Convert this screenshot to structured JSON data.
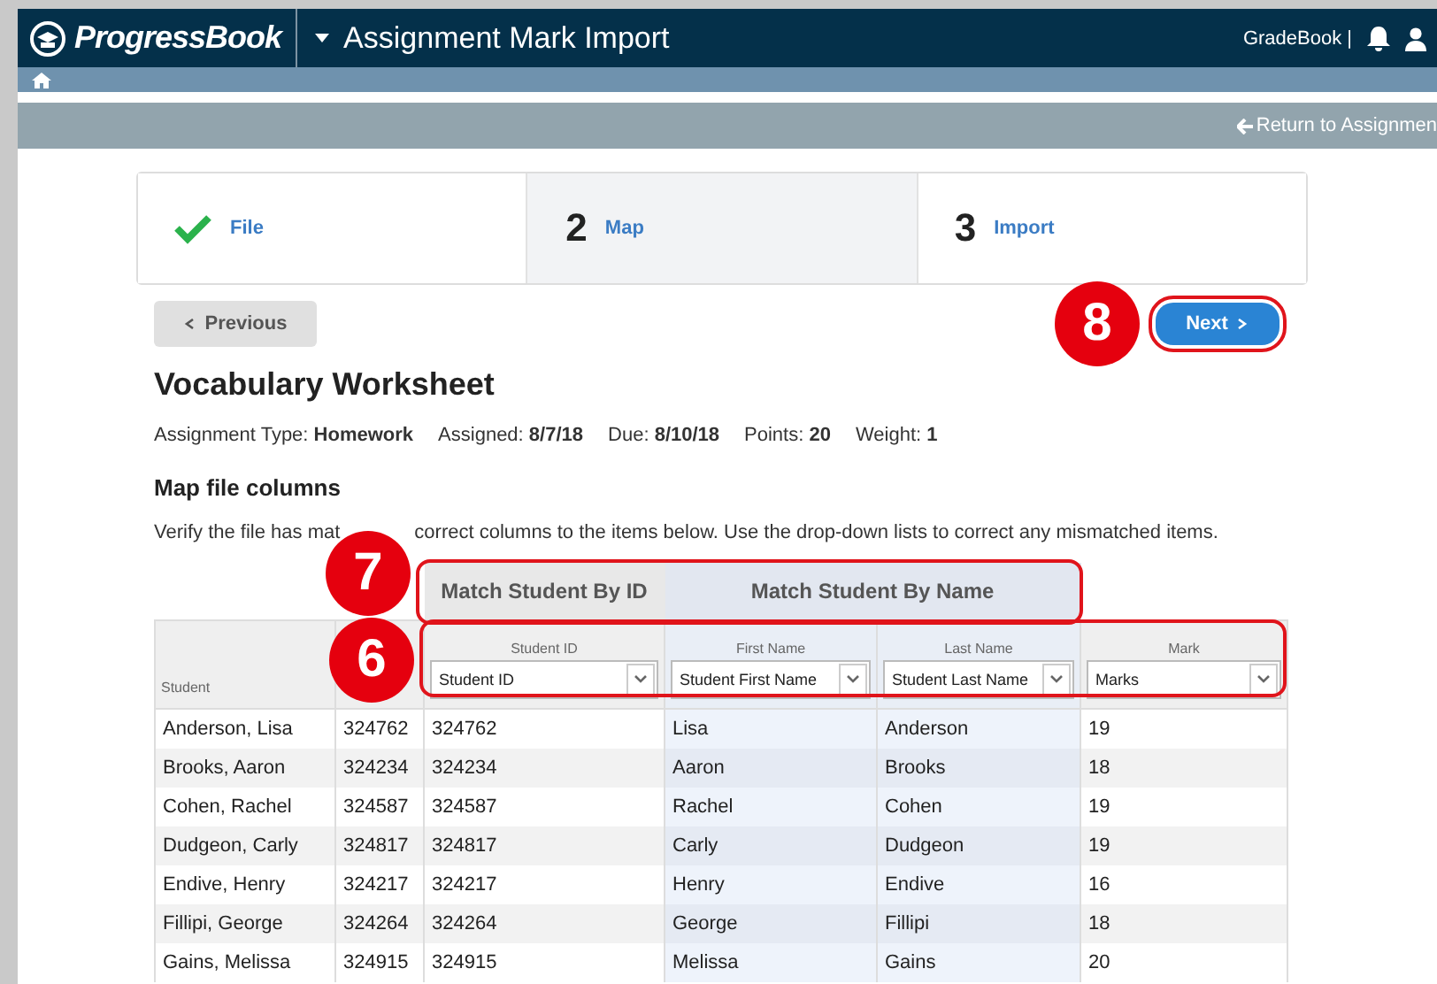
{
  "header": {
    "logo": "ProgressBook",
    "title": "Assignment Mark Import",
    "user_menu": "GradeBook |"
  },
  "return_link": "Return to Assignmen",
  "steps": [
    {
      "label": "File",
      "completed": true,
      "selected": false
    },
    {
      "number": "2",
      "label": "Map",
      "completed": false,
      "selected": true
    },
    {
      "number": "3",
      "label": "Import",
      "completed": false,
      "selected": false
    }
  ],
  "buttons": {
    "previous": "Previous",
    "next": "Next"
  },
  "assignment": {
    "title": "Vocabulary Worksheet",
    "details": [
      {
        "label": "Assignment Type:",
        "value": "Homework"
      },
      {
        "label": "Assigned:",
        "value": "8/7/18"
      },
      {
        "label": "Due:",
        "value": "8/10/18"
      },
      {
        "label": "Points:",
        "value": "20"
      },
      {
        "label": "Weight:",
        "value": "1"
      }
    ]
  },
  "section_title": "Map file columns",
  "instructions": [
    "Verify the file has mat",
    "correct columns to the items below. Use the drop-down lists to correct any mismatched items."
  ],
  "callouts": [
    "8",
    "7",
    "6"
  ],
  "columns": [
    {
      "kind": "label",
      "header": "Student"
    },
    {
      "kind": "blank"
    },
    {
      "kind": "gray_group",
      "label": "Match Student By ID",
      "columns": [
        {
          "kind": "select",
          "header": "Student ID",
          "value": "Student ID"
        }
      ]
    },
    {
      "kind": "blue_group",
      "label": "Match Student By Name",
      "columns": [
        {
          "kind": "select",
          "header": "First Name",
          "value": "Student First Name"
        },
        {
          "kind": "select",
          "header": "Last Name",
          "value": "Student Last Name"
        }
      ]
    },
    {
      "kind": "select",
      "header": "Mark",
      "value": "Marks"
    }
  ],
  "rows": [
    [
      "Anderson, Lisa",
      "324762",
      "324762",
      "Lisa",
      "Anderson",
      "19"
    ],
    [
      "Brooks, Aaron",
      "324234",
      "324234",
      "Aaron",
      "Brooks",
      "18"
    ],
    [
      "Cohen, Rachel",
      "324587",
      "324587",
      "Rachel",
      "Cohen",
      "19"
    ],
    [
      "Dudgeon, Carly",
      "324817",
      "324817",
      "Carly",
      "Dudgeon",
      "19"
    ],
    [
      "Endive, Henry",
      "324217",
      "324217",
      "Henry",
      "Endive",
      "16"
    ],
    [
      "Fillipi, George",
      "324264",
      "324264",
      "George",
      "Fillipi",
      "18"
    ],
    [
      "Gains, Melissa",
      "324915",
      "324915",
      "Melissa",
      "Gains",
      "20"
    ]
  ]
}
